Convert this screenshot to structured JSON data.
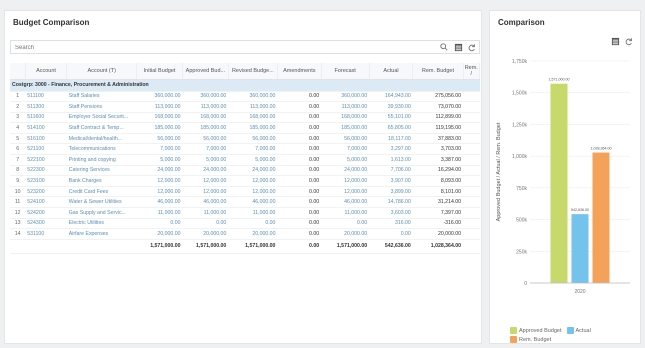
{
  "left_panel": {
    "title": "Budget Comparison",
    "search": {
      "placeholder": "Search"
    },
    "columns": [
      "",
      "Account",
      "Account (T)",
      "Initial Budget",
      "Approved Bud...",
      "Revised Budge...",
      "Amendments",
      "Forecast",
      "Actual",
      "Rem. Budget",
      "Rem. /"
    ],
    "group_row": "Costgrp: 3000 - Finance, Procurement & Administration",
    "rows": [
      {
        "idx": "1",
        "account": "511100",
        "desc": "Staff Salaries",
        "initial": "360,000.00",
        "approved": "360,000.00",
        "revised": "360,000.00",
        "amend": "0.00",
        "forecast": "360,000.00",
        "actual": "164,943.00",
        "rem": "275,056.00",
        "neg": false
      },
      {
        "idx": "2",
        "account": "511300",
        "desc": "Staff Pensions",
        "initial": "113,000.00",
        "approved": "113,000.00",
        "revised": "113,000.00",
        "amend": "0.00",
        "forecast": "113,000.00",
        "actual": "39,930.00",
        "rem": "73,070.00",
        "neg": false
      },
      {
        "idx": "3",
        "account": "511600",
        "desc": "Employer Social Securit...",
        "initial": "168,000.00",
        "approved": "168,000.00",
        "revised": "168,000.00",
        "amend": "0.00",
        "forecast": "168,000.00",
        "actual": "55,101.00",
        "rem": "112,899.00",
        "neg": false
      },
      {
        "idx": "4",
        "account": "514100",
        "desc": "Staff Contract & Temp...",
        "initial": "185,000.00",
        "approved": "185,000.00",
        "revised": "185,000.00",
        "amend": "0.00",
        "forecast": "185,000.00",
        "actual": "65,805.00",
        "rem": "119,195.00",
        "neg": false
      },
      {
        "idx": "5",
        "account": "516100",
        "desc": "Medical/dental/health...",
        "initial": "56,000.00",
        "approved": "56,000.00",
        "revised": "56,000.00",
        "amend": "0.00",
        "forecast": "56,000.00",
        "actual": "18,117.00",
        "rem": "37,883.00",
        "neg": false
      },
      {
        "idx": "6",
        "account": "521100",
        "desc": "Telecommunications",
        "initial": "7,000.00",
        "approved": "7,000.00",
        "revised": "7,000.00",
        "amend": "0.00",
        "forecast": "7,000.00",
        "actual": "3,297.00",
        "rem": "3,703.00",
        "neg": false
      },
      {
        "idx": "7",
        "account": "522100",
        "desc": "Printing and copying",
        "initial": "5,000.00",
        "approved": "5,000.00",
        "revised": "5,000.00",
        "amend": "0.00",
        "forecast": "5,000.00",
        "actual": "1,613.00",
        "rem": "3,387.00",
        "neg": false
      },
      {
        "idx": "8",
        "account": "522300",
        "desc": "Catering Services",
        "initial": "24,000.00",
        "approved": "24,000.00",
        "revised": "24,000.00",
        "amend": "0.00",
        "forecast": "24,000.00",
        "actual": "7,706.00",
        "rem": "16,294.00",
        "neg": false
      },
      {
        "idx": "9",
        "account": "523100",
        "desc": "Bank Charges",
        "initial": "12,000.00",
        "approved": "12,000.00",
        "revised": "12,000.00",
        "amend": "0.00",
        "forecast": "12,000.00",
        "actual": "3,907.00",
        "rem": "8,093.00",
        "neg": false
      },
      {
        "idx": "10",
        "account": "523200",
        "desc": "Credit Card Fees",
        "initial": "12,000.00",
        "approved": "12,000.00",
        "revised": "12,000.00",
        "amend": "0.00",
        "forecast": "12,000.00",
        "actual": "3,899.00",
        "rem": "8,101.00",
        "neg": false
      },
      {
        "idx": "11",
        "account": "524100",
        "desc": "Water & Sewer Utilities",
        "initial": "46,000.00",
        "approved": "46,000.00",
        "revised": "46,000.00",
        "amend": "0.00",
        "forecast": "46,000.00",
        "actual": "14,786.00",
        "rem": "31,214.00",
        "neg": false
      },
      {
        "idx": "12",
        "account": "524200",
        "desc": "Gas Supply and Servic...",
        "initial": "11,000.00",
        "approved": "11,000.00",
        "revised": "11,000.00",
        "amend": "0.00",
        "forecast": "11,000.00",
        "actual": "3,603.00",
        "rem": "7,397.00",
        "neg": false
      },
      {
        "idx": "13",
        "account": "524300",
        "desc": "Electric Utilities",
        "initial": "0.00",
        "approved": "0.00",
        "revised": "0.00",
        "amend": "0.00",
        "forecast": "0.00",
        "actual": "316.00",
        "rem": "-316.00",
        "neg": true
      },
      {
        "idx": "14",
        "account": "531100",
        "desc": "Airfare Expenses",
        "initial": "20,000.00",
        "approved": "20,000.00",
        "revised": "20,000.00",
        "amend": "0.00",
        "forecast": "20,000.00",
        "actual": "0.00",
        "rem": "20,000.00",
        "neg": false
      }
    ],
    "totals": {
      "initial": "1,571,000.00",
      "approved": "1,571,000.00",
      "revised": "1,571,000.00",
      "amend": "0.00",
      "forecast": "1,571,000.00",
      "actual": "542,636.00",
      "rem": "1,028,364.00"
    }
  },
  "right_panel": {
    "title": "Comparison",
    "colors": {
      "approved": "#c7d96b",
      "actual": "#74c3ec",
      "remaining": "#f4a259"
    }
  },
  "chart_data": {
    "type": "bar",
    "categories": [
      "2020"
    ],
    "series": [
      {
        "name": "Approved Budget",
        "values": [
          1571000
        ],
        "label": "1,571,000.00"
      },
      {
        "name": "Actual",
        "values": [
          542636
        ],
        "label": "542,636.00"
      },
      {
        "name": "Rem. Budget",
        "values": [
          1028364
        ],
        "label": "1,028,364.00"
      }
    ],
    "ylabel": "Approved Budget / Actual / Rem. Budget",
    "yticks": [
      "0",
      "250k",
      "500k",
      "750k",
      "1,000k",
      "1,250k",
      "1,500k",
      "1,750k"
    ],
    "ylim": [
      0,
      1750000
    ],
    "legend_position": "bottom"
  }
}
